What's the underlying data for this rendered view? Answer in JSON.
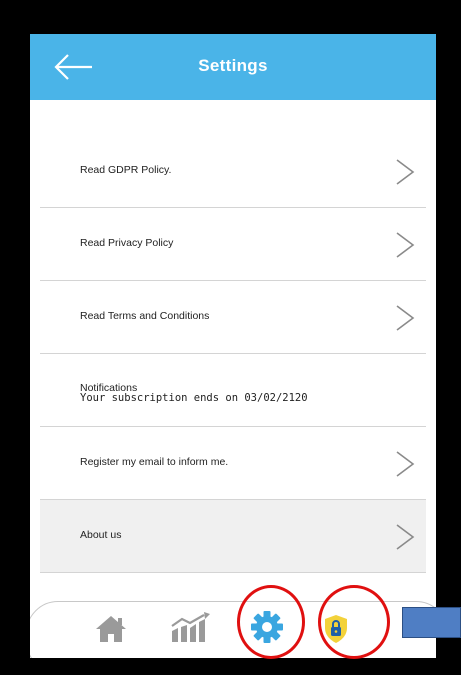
{
  "header": {
    "title": "Settings",
    "back_icon": "arrow-left-icon"
  },
  "settings": {
    "gdpr": "Read GDPR Policy.",
    "privacy": "Read Privacy Policy",
    "terms": "Read Terms and Conditions",
    "notifications_title": "Notifications",
    "notifications_sub": "Your subscription ends on 03/02/2120",
    "register": "Register my email to inform me.",
    "about": "About us"
  },
  "tabbar": {
    "items": [
      {
        "icon": "home-icon"
      },
      {
        "icon": "chart-icon"
      },
      {
        "icon": "gear-icon",
        "selected": true
      },
      {
        "icon": "shield-lock-icon"
      }
    ]
  },
  "colors": {
    "appbar": "#4ab4e8",
    "icon_gray": "#9a9a9a",
    "gear": "#3aa6e0",
    "highlight": "#e01010",
    "shield": "#f3d23a",
    "callout": "#4f7ec4"
  }
}
